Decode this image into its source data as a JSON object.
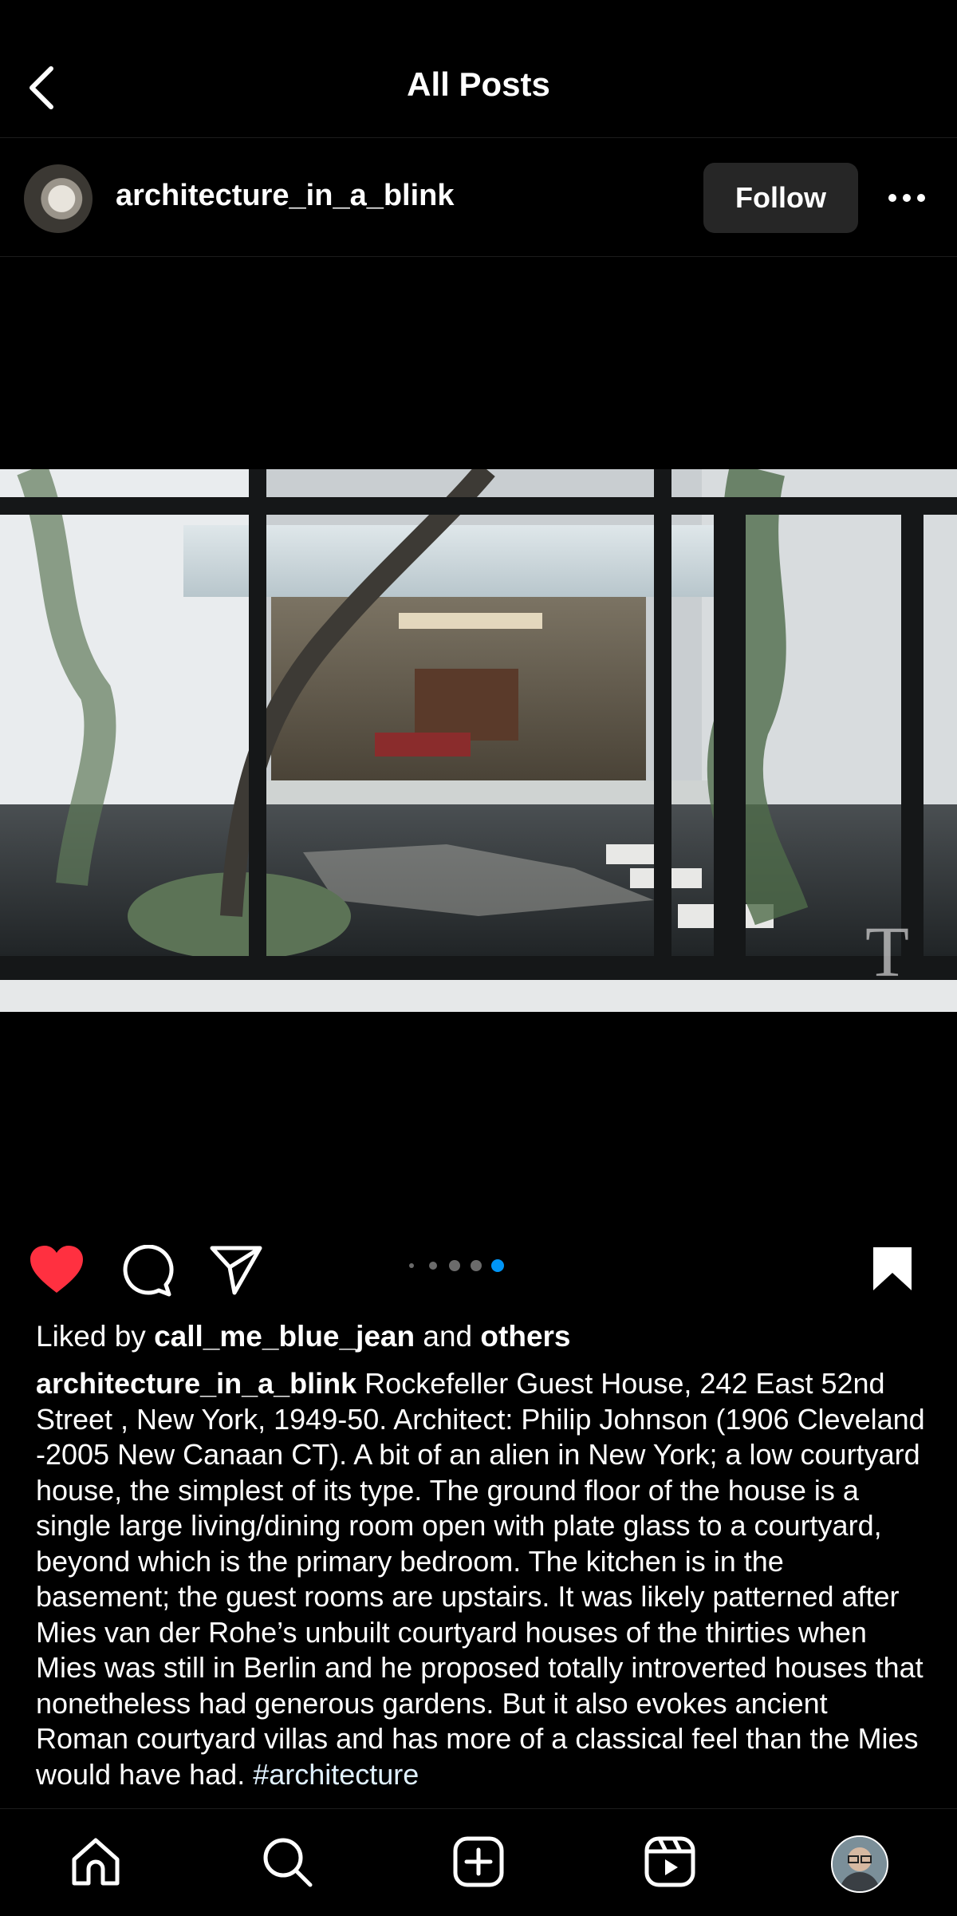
{
  "header": {
    "title": "All Posts"
  },
  "post": {
    "username": "architecture_in_a_blink",
    "follow_label": "Follow",
    "image_icon": "photo-courtyard",
    "carousel": {
      "count": 5,
      "active_index": 4
    },
    "liked": true,
    "likes": {
      "prefix": "Liked by ",
      "user": "call_me_blue_jean",
      "middle": " and ",
      "others": "others"
    },
    "caption": {
      "user": "architecture_in_a_blink",
      "text": " Rockefeller Guest House, 242 East 52nd Street , New York, 1949-50. Architect: Philip Johnson (1906 Cleveland -2005 New Canaan CT). A bit of an alien in New York; a low courtyard house, the simplest of its type. The ground floor of the house is a single large living/dining room open with plate glass to a courtyard, beyond which is the primary bedroom. The kitchen is in the basement; the guest rooms are upstairs. It was likely patterned after Mies van der Rohe’s unbuilt courtyard houses of the thirties when Mies was still in Berlin and he proposed totally introverted houses that nonetheless had generous gardens. But it also evokes ancient Roman courtyard villas and has more of a classical feel than the Mies would have had. ",
      "hashtag": "#architecture"
    }
  },
  "nav": [
    "home-icon",
    "search-icon",
    "create-icon",
    "reels-icon",
    "profile-avatar"
  ],
  "colors": {
    "like": "#ff3040",
    "accent": "#0095f6",
    "button_bg": "#262626"
  }
}
